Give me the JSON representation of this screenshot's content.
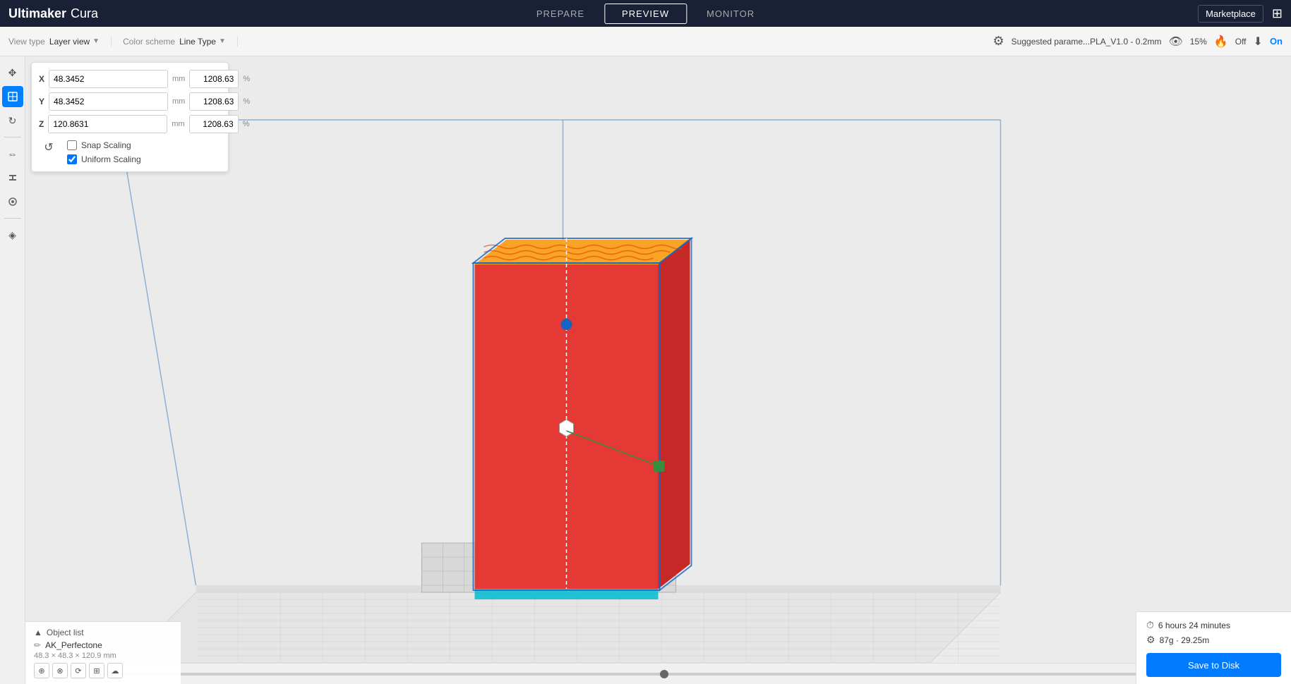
{
  "titlebar": {
    "logo_ultimaker": "Ultimaker",
    "logo_cura": "Cura",
    "nav_prepare": "PREPARE",
    "nav_preview": "PREVIEW",
    "nav_monitor": "MONITOR",
    "marketplace_label": "Marketplace",
    "active_tab": "PREVIEW"
  },
  "topbar": {
    "view_type_label": "View type",
    "view_type_value": "Layer view",
    "color_scheme_label": "Color scheme",
    "color_scheme_value": "Line Type",
    "param_label": "Suggested parame...PLA_V1.0 - 0.2mm",
    "percent_label": "15%",
    "off_label": "Off",
    "on_label": "On"
  },
  "scale_panel": {
    "x_label": "X",
    "x_mm": "48.3452",
    "x_mm_unit": "mm",
    "x_pct": "1208.63",
    "x_pct_sym": "%",
    "y_label": "Y",
    "y_mm": "48.3452",
    "y_mm_unit": "mm",
    "y_pct": "1208.63",
    "y_pct_sym": "%",
    "z_label": "Z",
    "z_mm": "120.8631",
    "z_mm_unit": "mm",
    "z_pct": "1208.63",
    "z_pct_sym": "%",
    "snap_scaling_label": "Snap Scaling",
    "uniform_scaling_label": "Uniform Scaling"
  },
  "object_list": {
    "header": "Object list",
    "item_name": "AK_Perfectone",
    "item_dims": "48.3 × 48.3 × 120.9 mm"
  },
  "print_info": {
    "time_icon": "⏱",
    "time_value": "6 hours 24 minutes",
    "material_icon": "⚙",
    "material_value": "87g · 29.25m",
    "save_btn_label": "Save to Disk"
  },
  "tools": [
    {
      "name": "move",
      "icon": "✥",
      "active": false
    },
    {
      "name": "scale",
      "icon": "⬡",
      "active": true
    },
    {
      "name": "rotate",
      "icon": "↻",
      "active": false
    },
    {
      "name": "mirror",
      "icon": "⊞",
      "active": false
    },
    {
      "name": "support",
      "icon": "⧉",
      "active": false
    },
    {
      "name": "paint",
      "icon": "⬡",
      "active": false
    }
  ]
}
